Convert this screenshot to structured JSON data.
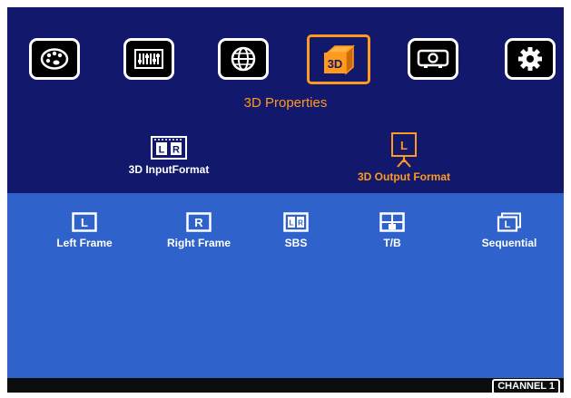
{
  "menu": {
    "tabs": [
      {
        "icon": "palette-icon",
        "active": false
      },
      {
        "icon": "mixer-sliders-icon",
        "active": false
      },
      {
        "icon": "globe-icon",
        "active": false
      },
      {
        "icon": "3d-cube-icon",
        "active": true
      },
      {
        "icon": "projector-icon",
        "active": false
      },
      {
        "icon": "gear-icon",
        "active": false
      }
    ],
    "section_title": "3D Properties"
  },
  "modes": {
    "input": {
      "label": "3D InputFormat",
      "icon": "lr-frame-icon",
      "color": "#ffffff"
    },
    "output": {
      "label": "3D Output Format",
      "icon": "projector-screen-icon",
      "color": "#ff9a1e",
      "selected": true
    }
  },
  "formats": [
    {
      "label": "Left Frame",
      "icon": "left-frame-icon"
    },
    {
      "label": "Right Frame",
      "icon": "right-frame-icon"
    },
    {
      "label": "SBS",
      "icon": "side-by-side-icon"
    },
    {
      "label": "T/B",
      "icon": "top-bottom-icon"
    },
    {
      "label": "Sequential",
      "icon": "sequential-icon"
    }
  ],
  "status": {
    "channel": "CHANNEL 1"
  },
  "colors": {
    "accent": "#ff9a1e",
    "top_band": "#12186c",
    "bottom_band": "#2f62ca"
  }
}
